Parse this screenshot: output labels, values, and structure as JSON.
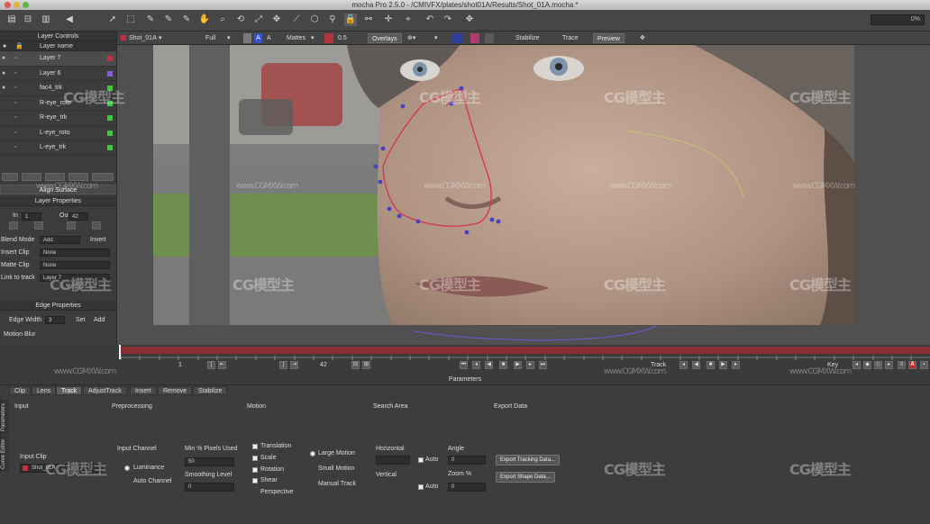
{
  "window": {
    "title": "mocha Pro 2.5.0 - /CMIVFX/plates/shot01A/Results/Shot_01A.mocha *"
  },
  "toolbar": {
    "frame_field": "0%"
  },
  "viewbar": {
    "clip": "Shot_01A",
    "view_mode": "Full",
    "text_a": "A",
    "mattes": "Mattes",
    "overlays": "Overlays",
    "zoom": "0.5",
    "stabilize": "Stabilize",
    "trace": "Trace",
    "preview": "Preview"
  },
  "layer_controls": {
    "title": "Layer Controls",
    "column_header": "Layer name",
    "layers": [
      {
        "name": "Layer 7",
        "color": "#c03040"
      },
      {
        "name": "Layer 6",
        "color": "#8a5ad8"
      },
      {
        "name": "fac4_trk",
        "color": "#3ec83e"
      },
      {
        "name": "R-eye_roto",
        "color": "#3ec83e"
      },
      {
        "name": "R-eye_trk",
        "color": "#3ec83e"
      },
      {
        "name": "L-eye_roto",
        "color": "#3ec83e"
      },
      {
        "name": "L-eye_trk",
        "color": "#3ec83e"
      }
    ],
    "align_surface": "Align Surface"
  },
  "layer_properties": {
    "title": "Layer Properties",
    "in_label": "In",
    "in_value": "1",
    "out_label": "Out",
    "out_value": "42",
    "blend_mode_label": "Blend Mode",
    "blend_mode_value": "Add",
    "invert_label": "Invert",
    "insert_clip_label": "Insert Clip",
    "insert_clip_value": "None",
    "matte_clip_label": "Matte Clip",
    "matte_clip_value": "None",
    "link_to_track_label": "Link to track",
    "link_to_track_value": "Layer 7"
  },
  "edge_properties": {
    "title": "Edge Properties",
    "edge_width_label": "Edge Width",
    "edge_width_value": "3",
    "set_label": "Set",
    "add_label": "Add",
    "motion_blur_label": "Motion Blur"
  },
  "timeline": {
    "start_frame": "1",
    "end_frame": "42",
    "track_label": "Track",
    "key_label": "Key"
  },
  "parameters": {
    "title": "Parameters",
    "side_tabs": [
      "Parameters",
      "Curve Editor"
    ],
    "tabs": [
      "Clip",
      "Lens",
      "Track",
      "AdjustTrack",
      "Insert",
      "Remove",
      "Stabilize"
    ],
    "active_tab": "Track",
    "sections": {
      "input": "Input",
      "preprocessing": "Preprocessing",
      "motion": "Motion",
      "search_area": "Search Area",
      "export_data": "Export Data"
    },
    "input_clip_label": "Input Clip",
    "input_clip_value": "Shot_01A",
    "input_channel_label": "Input Channel",
    "luminance_label": "Luminance",
    "auto_channel_label": "Auto Channel",
    "min_pixels_label": "Min % Pixels Used",
    "min_pixels_value": "50",
    "smoothing_label": "Smoothing Level",
    "smoothing_value": "0",
    "motion_options": [
      "Translation",
      "Scale",
      "Rotation",
      "Shear",
      "Perspective"
    ],
    "large_motion": "Large Motion",
    "small_motion": "Small Motion",
    "manual_track": "Manual Track",
    "horizontal_label": "Horizontal",
    "vertical_label": "Vertical",
    "angle_label": "Angle",
    "auto_label": "Auto",
    "zoom_label": "Zoom %",
    "angle_value": "0",
    "zoom_value": "0",
    "export_tracking": "Export Tracking Data...",
    "export_shape": "Export Shape Data..."
  },
  "watermarks": [
    "CG模型主",
    "www.CGMXW.com"
  ],
  "colors": {
    "spline": "#d23a52",
    "control_point": "#4a40c8",
    "timeline_track": "#8a2e36"
  }
}
